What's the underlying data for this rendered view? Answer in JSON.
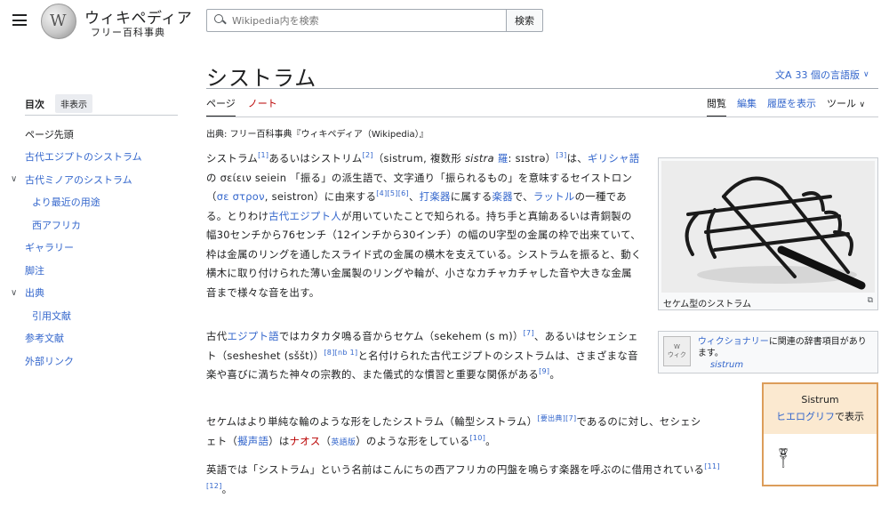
{
  "header": {
    "logo_word": "ウィキペディア",
    "logo_tagline": "フリー百科事典",
    "search_placeholder": "Wikipedia内を検索",
    "search_button": "検索"
  },
  "toc": {
    "title": "目次",
    "hide_label": "非表示",
    "items": [
      {
        "label": "ページ先頭",
        "chev": ""
      },
      {
        "label": "古代エジプトのシストラム",
        "chev": ""
      },
      {
        "label": "古代ミノアのシストラム",
        "chev": "∨"
      },
      {
        "label": "より最近の用途",
        "chev": ""
      },
      {
        "label": "西アフリカ",
        "chev": ""
      },
      {
        "label": "ギャラリー",
        "chev": ""
      },
      {
        "label": "脚注",
        "chev": ""
      },
      {
        "label": "出典",
        "chev": "∨"
      },
      {
        "label": "引用文献",
        "chev": ""
      },
      {
        "label": "参考文献",
        "chev": ""
      },
      {
        "label": "外部リンク",
        "chev": ""
      }
    ]
  },
  "article": {
    "title": "シストラム",
    "languages": "33 個の言語版",
    "tabs_left": [
      "ページ",
      "ノート"
    ],
    "tabs_right": [
      "閲覧",
      "編集",
      "履歴を表示",
      "ツール"
    ],
    "source": "出典: フリー百科事典『ウィキペディア（Wikipedia）』",
    "image_caption": "セケム型のシストラム",
    "wiktionary_link": "ウィクショナリー",
    "wiktionary_rest": "に関連の辞書項目があります。",
    "wiktionary_term": "sistrum",
    "hiero_title": "Sistrum",
    "hiero_link": "ヒエログリフ",
    "hiero_rest": "で表示",
    "hiero_glyph": "𓏣"
  },
  "colors": {
    "link": "#3366cc",
    "redlink": "#ba0000",
    "hiero_border": "#dc9d5a",
    "hiero_bg": "#fbe9d0"
  }
}
